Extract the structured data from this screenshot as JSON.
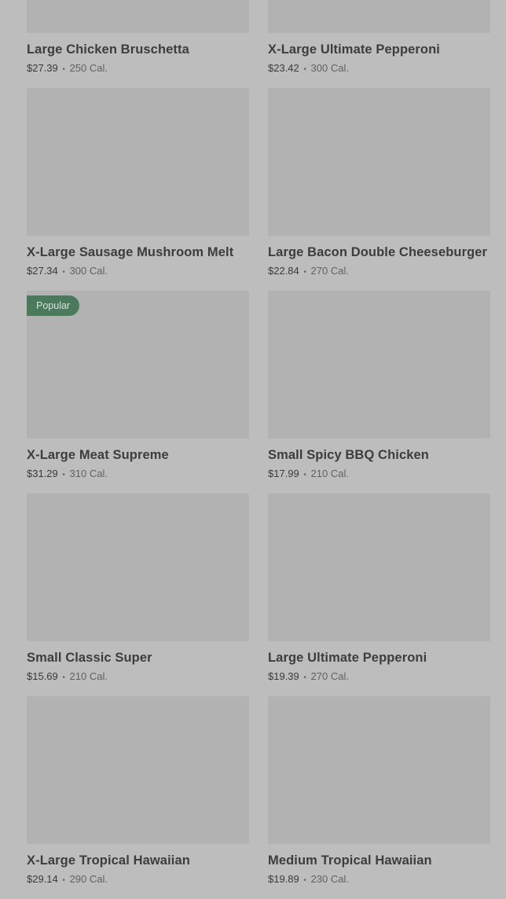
{
  "menu": {
    "items": [
      {
        "name": "Large Chicken Bruschetta",
        "price": "$27.39",
        "calories": "250 Cal.",
        "badge": ""
      },
      {
        "name": "X-Large Ultimate Pepperoni",
        "price": "$23.42",
        "calories": "300 Cal.",
        "badge": ""
      },
      {
        "name": "X-Large Sausage Mushroom Melt",
        "price": "$27.34",
        "calories": "300 Cal.",
        "badge": ""
      },
      {
        "name": "Large Bacon Double Cheeseburger",
        "price": "$22.84",
        "calories": "270 Cal.",
        "badge": ""
      },
      {
        "name": "X-Large Meat Supreme",
        "price": "$31.29",
        "calories": "310 Cal.",
        "badge": "Popular"
      },
      {
        "name": "Small Spicy BBQ Chicken",
        "price": "$17.99",
        "calories": "210 Cal.",
        "badge": ""
      },
      {
        "name": "Small Classic Super",
        "price": "$15.69",
        "calories": "210 Cal.",
        "badge": ""
      },
      {
        "name": "Large Ultimate Pepperoni",
        "price": "$19.39",
        "calories": "270 Cal.",
        "badge": ""
      },
      {
        "name": "X-Large Tropical Hawaiian",
        "price": "$29.14",
        "calories": "290 Cal.",
        "badge": ""
      },
      {
        "name": "Medium Tropical Hawaiian",
        "price": "$19.89",
        "calories": "230 Cal.",
        "badge": ""
      }
    ],
    "separator": "•"
  }
}
